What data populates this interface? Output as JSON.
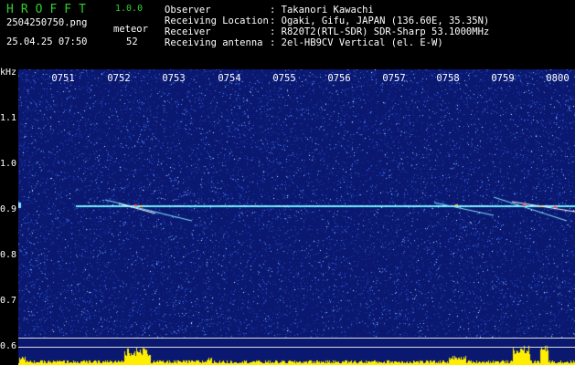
{
  "header": {
    "brand": "HROFFT",
    "version": "1.0.0",
    "filename": "2504250750.png",
    "datetime": "25.04.25 07:50",
    "meteor_label": "meteor",
    "meteor_count": "52",
    "observer_label": "Observer",
    "observer_value": ": Takanori Kawachi",
    "location_label": "Receiving Location",
    "location_value": ": Ogaki, Gifu, JAPAN (136.60E, 35.35N)",
    "receiver_label": "Receiver",
    "receiver_value": ": R820T2(RTL-SDR) SDR-Sharp 53.1000MHz",
    "antenna_label": "Receiving antenna",
    "antenna_value": ": 2el-HB9CV Vertical (el. E-W)"
  },
  "axes": {
    "y_unit": "kHz",
    "x_ticks": [
      "0751",
      "0752",
      "0753",
      "0754",
      "0755",
      "0756",
      "0757",
      "0758",
      "0759",
      "0800"
    ],
    "y_ticks": [
      "1.1",
      "1.0",
      "0.9",
      "0.8",
      "0.7",
      "0.6"
    ]
  },
  "colors": {
    "background": "#0a1870",
    "carrier": "#6ff0ff",
    "text_brand": "#2dd12d",
    "histogram": "#ffee00"
  }
}
